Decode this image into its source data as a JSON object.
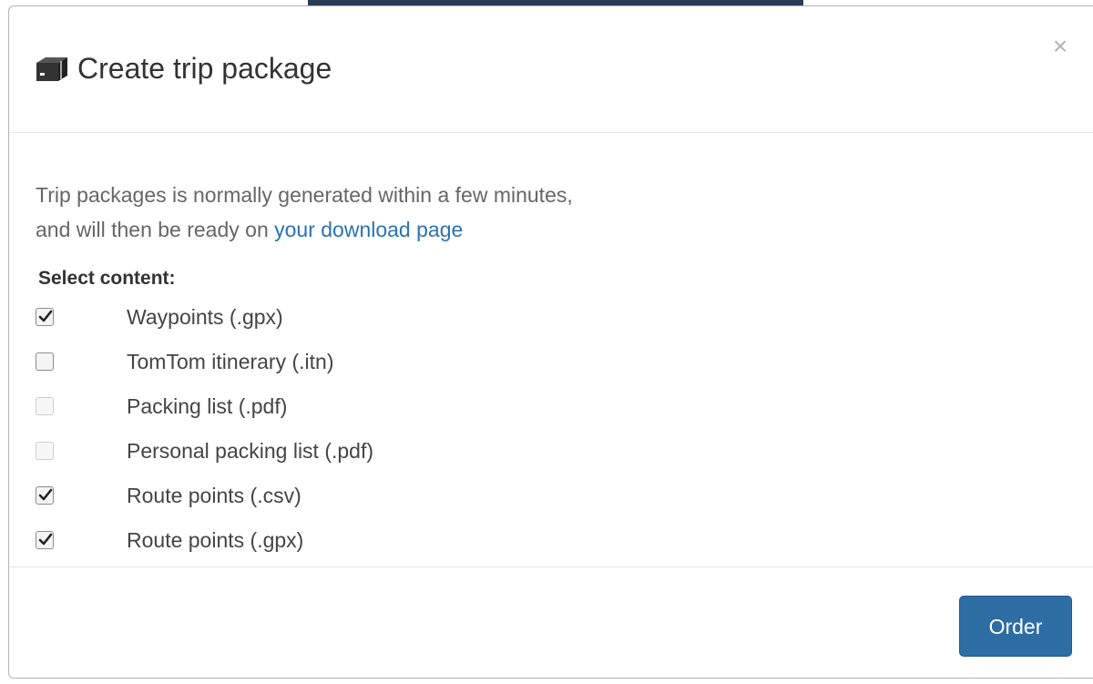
{
  "dialog": {
    "title": "Create trip package",
    "header_icon": "package-icon",
    "close_label": "×"
  },
  "body": {
    "intro_line1": "Trip packages is normally generated within a few minutes,",
    "intro_line2_prefix": "and will then be ready on ",
    "download_link": "your download page",
    "select_label": "Select content:",
    "options": [
      {
        "label": "Waypoints (.gpx)",
        "checked": true,
        "disabled": false
      },
      {
        "label": "TomTom itinerary (.itn)",
        "checked": false,
        "disabled": false
      },
      {
        "label": "Packing list (.pdf)",
        "checked": false,
        "disabled": true
      },
      {
        "label": "Personal packing list (.pdf)",
        "checked": false,
        "disabled": true
      },
      {
        "label": "Route points (.csv)",
        "checked": true,
        "disabled": false
      },
      {
        "label": "Route points (.gpx)",
        "checked": true,
        "disabled": false
      }
    ]
  },
  "footer": {
    "order_label": "Order"
  },
  "colors": {
    "primary": "#2e6da4",
    "link": "#2a72b5",
    "backdrop": "#2b3b57"
  }
}
